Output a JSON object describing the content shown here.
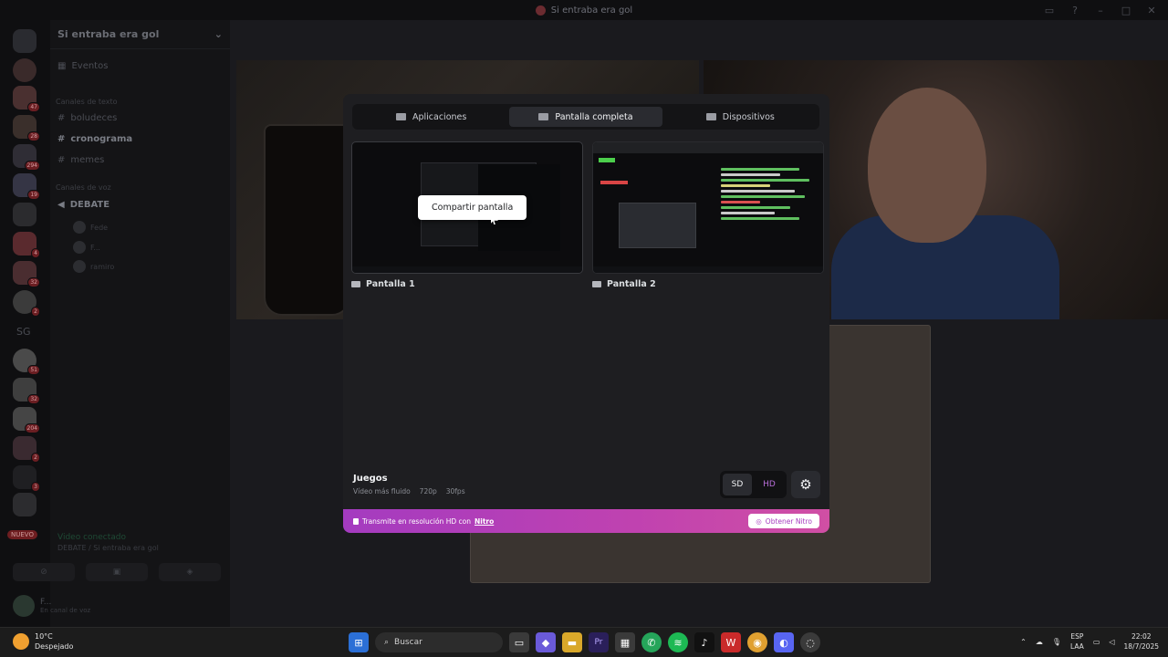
{
  "window": {
    "title": "Si entraba era gol"
  },
  "sidebar": {
    "server_name": "Si entraba era gol",
    "events": "Eventos",
    "text_category": "Canales de texto",
    "text_channels": [
      "boludeces",
      "cronograma",
      "memes"
    ],
    "voice_category": "Canales de voz",
    "voice_channel": "DEBATE",
    "voice_users": [
      "Fede",
      "F...",
      "ramiro"
    ],
    "voice_status": "Video conectado",
    "voice_location": "DEBATE / Si entraba era gol",
    "user_name": "F...",
    "user_status": "En canal de voz"
  },
  "rail": {
    "badges": [
      "47",
      "28",
      "294",
      "19",
      "4",
      "32",
      "2",
      "51",
      "32",
      "204",
      "2",
      "3"
    ],
    "folder_label": "SG",
    "new_label": "NUEVO"
  },
  "modal": {
    "tabs": [
      "Aplicaciones",
      "Pantalla completa",
      "Dispositivos"
    ],
    "active_tab": "Pantalla completa",
    "screens": [
      {
        "label": "Pantalla 1",
        "tooltip": "Compartir pantalla"
      },
      {
        "label": "Pantalla 2"
      }
    ],
    "quality": {
      "title": "Juegos",
      "desc": "Vídeo más fluido",
      "resolution": "720p",
      "fps": "30fps"
    },
    "res_options": [
      "SD",
      "HD"
    ],
    "nitro": {
      "text": "Transmite en resolución HD con",
      "link": "Nitro",
      "button": "Obtener Nitro"
    }
  },
  "taskbar": {
    "temp": "10°C",
    "weather": "Despejado",
    "search_placeholder": "Buscar",
    "lang_line1": "ESP",
    "lang_line2": "LAA",
    "time": "22:02",
    "date": "18/7/2025"
  },
  "colors": {
    "nitro_gradient_start": "#a43bc0",
    "nitro_gradient_end": "#d04fa4",
    "hd_accent": "#b86ed9"
  }
}
